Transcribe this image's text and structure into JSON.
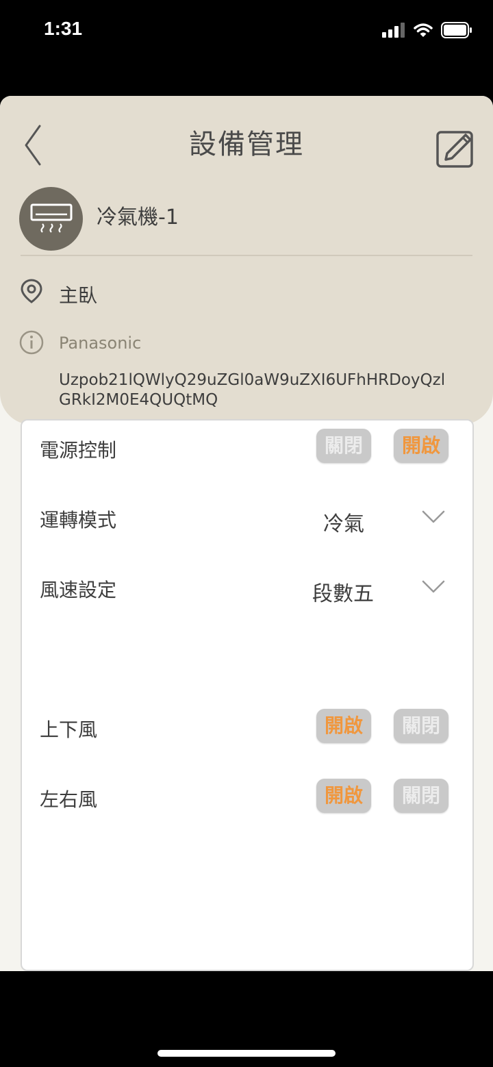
{
  "status_bar": {
    "time": "1:31"
  },
  "header": {
    "title": "設備管理"
  },
  "device": {
    "name": "冷氣機-1",
    "location": "主臥",
    "brand": "Panasonic",
    "id": "Uzpob21lQWlyQ29uZGl0aW9uZXI6UFhHRDoyQzlGRkI2M0E4QUQtMQ"
  },
  "controls": {
    "power": {
      "label": "電源控制",
      "btn_off": "關閉",
      "btn_on": "開啟"
    },
    "mode": {
      "label": "運轉模式",
      "value": "冷氣"
    },
    "fan_speed": {
      "label": "風速設定",
      "value": "段數五"
    },
    "swing_vertical": {
      "label": "上下風",
      "btn_on": "開啟",
      "btn_off": "關閉"
    },
    "swing_horizontal": {
      "label": "左右風",
      "btn_on": "開啟",
      "btn_off": "關閉"
    }
  },
  "colors": {
    "header_bg": "#e3ddd0",
    "accent": "#f0973e",
    "pill_bg": "#c9c9c9",
    "avatar_bg": "#6f6a5f"
  },
  "icons": {
    "back": "chevron-left-icon",
    "edit": "edit-icon",
    "device": "air-conditioner-icon",
    "location": "location-pin-icon",
    "info": "info-icon",
    "dropdown": "chevron-down-icon"
  }
}
